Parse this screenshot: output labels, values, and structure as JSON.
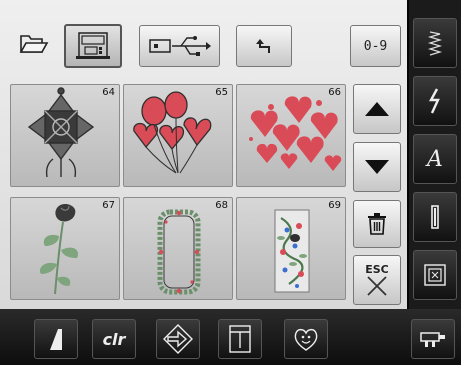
{
  "toolbar": {
    "folder_icon": "folder-open-icon",
    "machine_memory_icon": "sewing-machine-memory-icon",
    "usb_icon": "usb-stick-icon",
    "back_icon": "return-arrow-icon",
    "number_button_label": "0-9"
  },
  "designs": [
    {
      "number": "64",
      "icon": "ornamental-cross-design"
    },
    {
      "number": "65",
      "icon": "heart-balloons-design"
    },
    {
      "number": "66",
      "icon": "scattered-hearts-design"
    },
    {
      "number": "67",
      "icon": "rose-design"
    },
    {
      "number": "68",
      "icon": "floral-frame-design"
    },
    {
      "number": "69",
      "icon": "floral-border-design"
    }
  ],
  "side_controls": {
    "scroll_up_icon": "triangle-up-icon",
    "scroll_down_icon": "triangle-down-icon",
    "delete_icon": "trash-icon",
    "esc_label": "ESC"
  },
  "right_strip": {
    "items": [
      "zigzag-stitch-icon",
      "lightning-stitch-icon",
      "alphabet-icon",
      "buttonhole-icon",
      "embroidery-hoop-icon"
    ],
    "alphabet_label": "A"
  },
  "bottom_bar": {
    "items": [
      "stitch-width-icon",
      "clear-icon",
      "diamond-arrow-icon",
      "folder-tab-icon",
      "smiley-heart-icon",
      "embroidery-mode-icon"
    ],
    "clr_label": "clr"
  },
  "colors": {
    "panel": "#e6e6e6",
    "frame": "#151515",
    "tile": "#c8c8c8",
    "design_red": "#d94b56",
    "design_dark": "#2f2f2f"
  }
}
